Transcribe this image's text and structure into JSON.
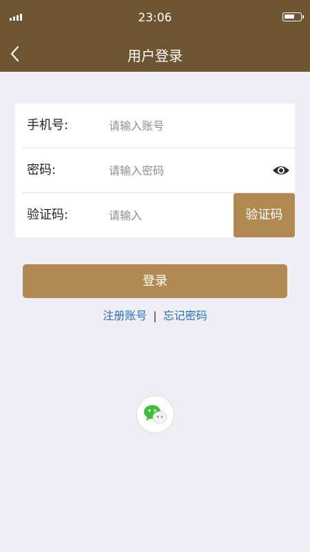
{
  "status_bar": {
    "time": "23:06"
  },
  "nav": {
    "title": "用户登录",
    "back_icon": "chevron-left-icon"
  },
  "form": {
    "phone": {
      "label": "手机号:",
      "placeholder": "请输入账号",
      "value": ""
    },
    "password": {
      "label": "密码:",
      "placeholder": "请输入密码",
      "value": "",
      "toggle_icon": "eye-icon"
    },
    "code": {
      "label": "验证码:",
      "placeholder": "请输入",
      "value": "",
      "button_label": "验证码"
    }
  },
  "actions": {
    "login_label": "登录",
    "register_label": "注册账号",
    "separator": "|",
    "forgot_label": "忘记密码"
  },
  "social": {
    "wechat_icon": "wechat-icon"
  },
  "colors": {
    "header_bg": "#6e5532",
    "accent": "#b08a52",
    "link": "#2a6fb5",
    "page_bg": "#efeef4"
  }
}
